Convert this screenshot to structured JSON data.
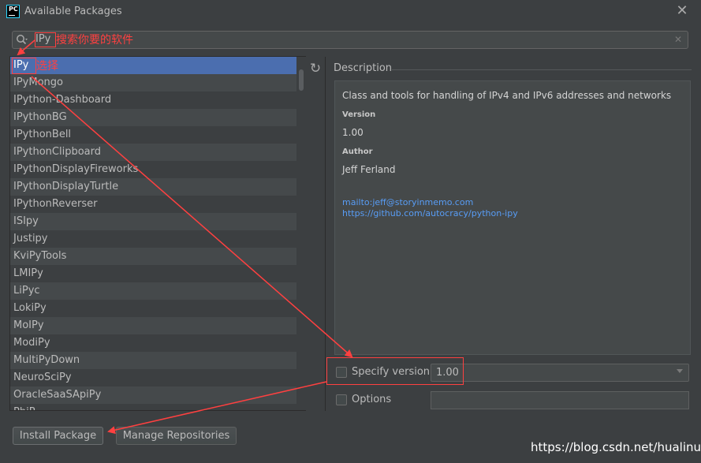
{
  "window": {
    "title": "Available Packages",
    "app_icon": "PC",
    "close_icon": "close-icon"
  },
  "search": {
    "value": "IPy",
    "icon": "search-icon",
    "clear_icon": "clear-icon"
  },
  "packages": [
    "IPy",
    "IPyMongo",
    "IPython-Dashboard",
    "IPythonBG",
    "IPythonBell",
    "IPythonClipboard",
    "IPythonDisplayFireworks",
    "IPythonDisplayTurtle",
    "IPythonReverser",
    "ISIpy",
    "Justipy",
    "KviPyTools",
    "LMIPy",
    "LiPyc",
    "LokiPy",
    "MoIPy",
    "ModiPy",
    "MultiPyDown",
    "NeuroSciPy",
    "OracleSaaSApiPy",
    "PhiP..."
  ],
  "selected_package": "IPy",
  "description": {
    "section_title": "Description",
    "summary": "Class and tools for handling of IPv4 and IPv6 addresses and networks",
    "version_label": "Version",
    "version": "1.00",
    "author_label": "Author",
    "author": "Jeff Ferland",
    "mailto": "mailto:jeff@storyinmemo.com",
    "url": "https://github.com/autocracy/python-ipy"
  },
  "options": {
    "specify_version_label": "Specify version",
    "specify_version_value": "1.00",
    "options_label": "Options",
    "options_value": ""
  },
  "buttons": {
    "install": "Install Package",
    "manage": "Manage Repositories"
  },
  "annotations": {
    "search_note": "搜索你要的软件",
    "select_note": "选择",
    "color": "#ff4040"
  },
  "watermark": "https://blog.csdn.net/hualinux"
}
